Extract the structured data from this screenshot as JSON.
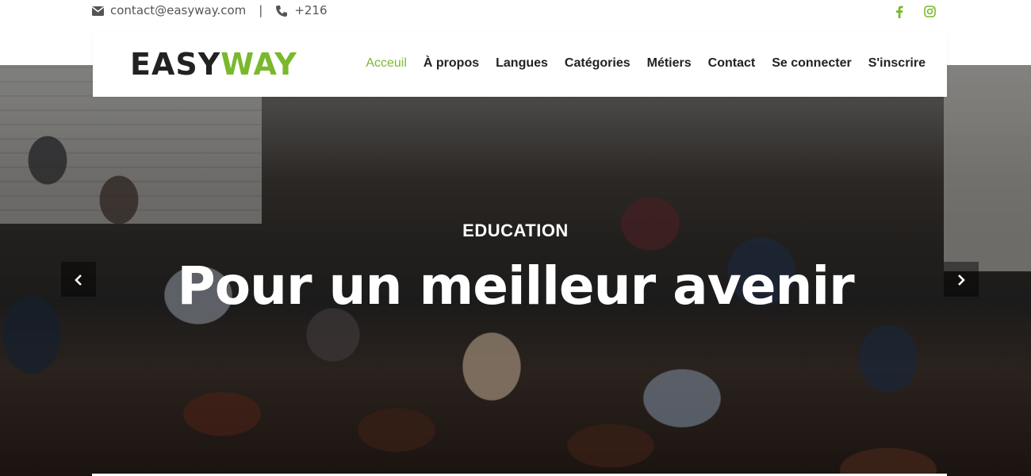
{
  "topbar": {
    "email": "contact@easyway.com",
    "separator": "|",
    "phone": "+216",
    "social": [
      {
        "name": "facebook-icon",
        "color": "#7ab82e"
      },
      {
        "name": "instagram-icon",
        "color": "#7ab82e"
      }
    ]
  },
  "navbar": {
    "logo_part1": "EASY",
    "logo_part2": "WAY",
    "menu": [
      {
        "label": "Acceuil",
        "active": true
      },
      {
        "label": "À propos",
        "active": false
      },
      {
        "label": "Langues",
        "active": false
      },
      {
        "label": "Catégories",
        "active": false
      },
      {
        "label": "Métiers",
        "active": false
      },
      {
        "label": "Contact",
        "active": false
      },
      {
        "label": "Se connecter",
        "active": false
      },
      {
        "label": "S'inscrire",
        "active": false
      }
    ]
  },
  "hero": {
    "subtitle": "EDUCATION",
    "title": "Pour un meilleur avenir",
    "prev_icon": "chevron-left-icon",
    "next_icon": "chevron-right-icon"
  },
  "colors": {
    "accent": "#7ab82e",
    "text_dark": "#222222"
  }
}
